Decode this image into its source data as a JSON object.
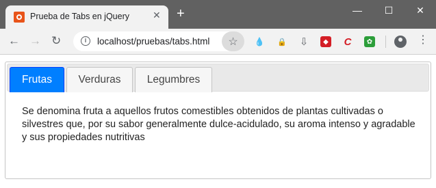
{
  "browser": {
    "tab_title": "Prueba de Tabs en jQuery",
    "tab_close": "✕",
    "new_tab": "+",
    "url": "localhost/pruebas/tabs.html",
    "window_controls": {
      "minimize": "—",
      "maximize": "☐",
      "close": "✕"
    },
    "nav": {
      "back": "←",
      "forward": "→",
      "reload": "↻"
    },
    "info_glyph": "i",
    "star_glyph": "☆",
    "menu_glyph": "⋮"
  },
  "extensions": [
    {
      "name": "drop-icon",
      "glyph": "💧"
    },
    {
      "name": "lock-icon",
      "glyph": "🔒"
    },
    {
      "name": "download-tray-icon",
      "glyph": "⇩"
    },
    {
      "name": "red-square-extension-icon",
      "glyph": "◆"
    },
    {
      "name": "red-c-extension-icon",
      "glyph": "C"
    },
    {
      "name": "green-puzzle-extension-icon",
      "glyph": "✿"
    }
  ],
  "tabs": {
    "items": [
      {
        "label": "Frutas",
        "active": true
      },
      {
        "label": "Verduras",
        "active": false
      },
      {
        "label": "Legumbres",
        "active": false
      }
    ],
    "panel_text": "Se denomina fruta a aquellos frutos comestibles obtenidos de plantas cultivadas o silvestres que, por su sabor generalmente dulce-acidulado, su aroma intenso y agradable y sus propiedades nutritivas"
  },
  "colors": {
    "active_tab": "#007fff",
    "titlebar": "#616161"
  }
}
